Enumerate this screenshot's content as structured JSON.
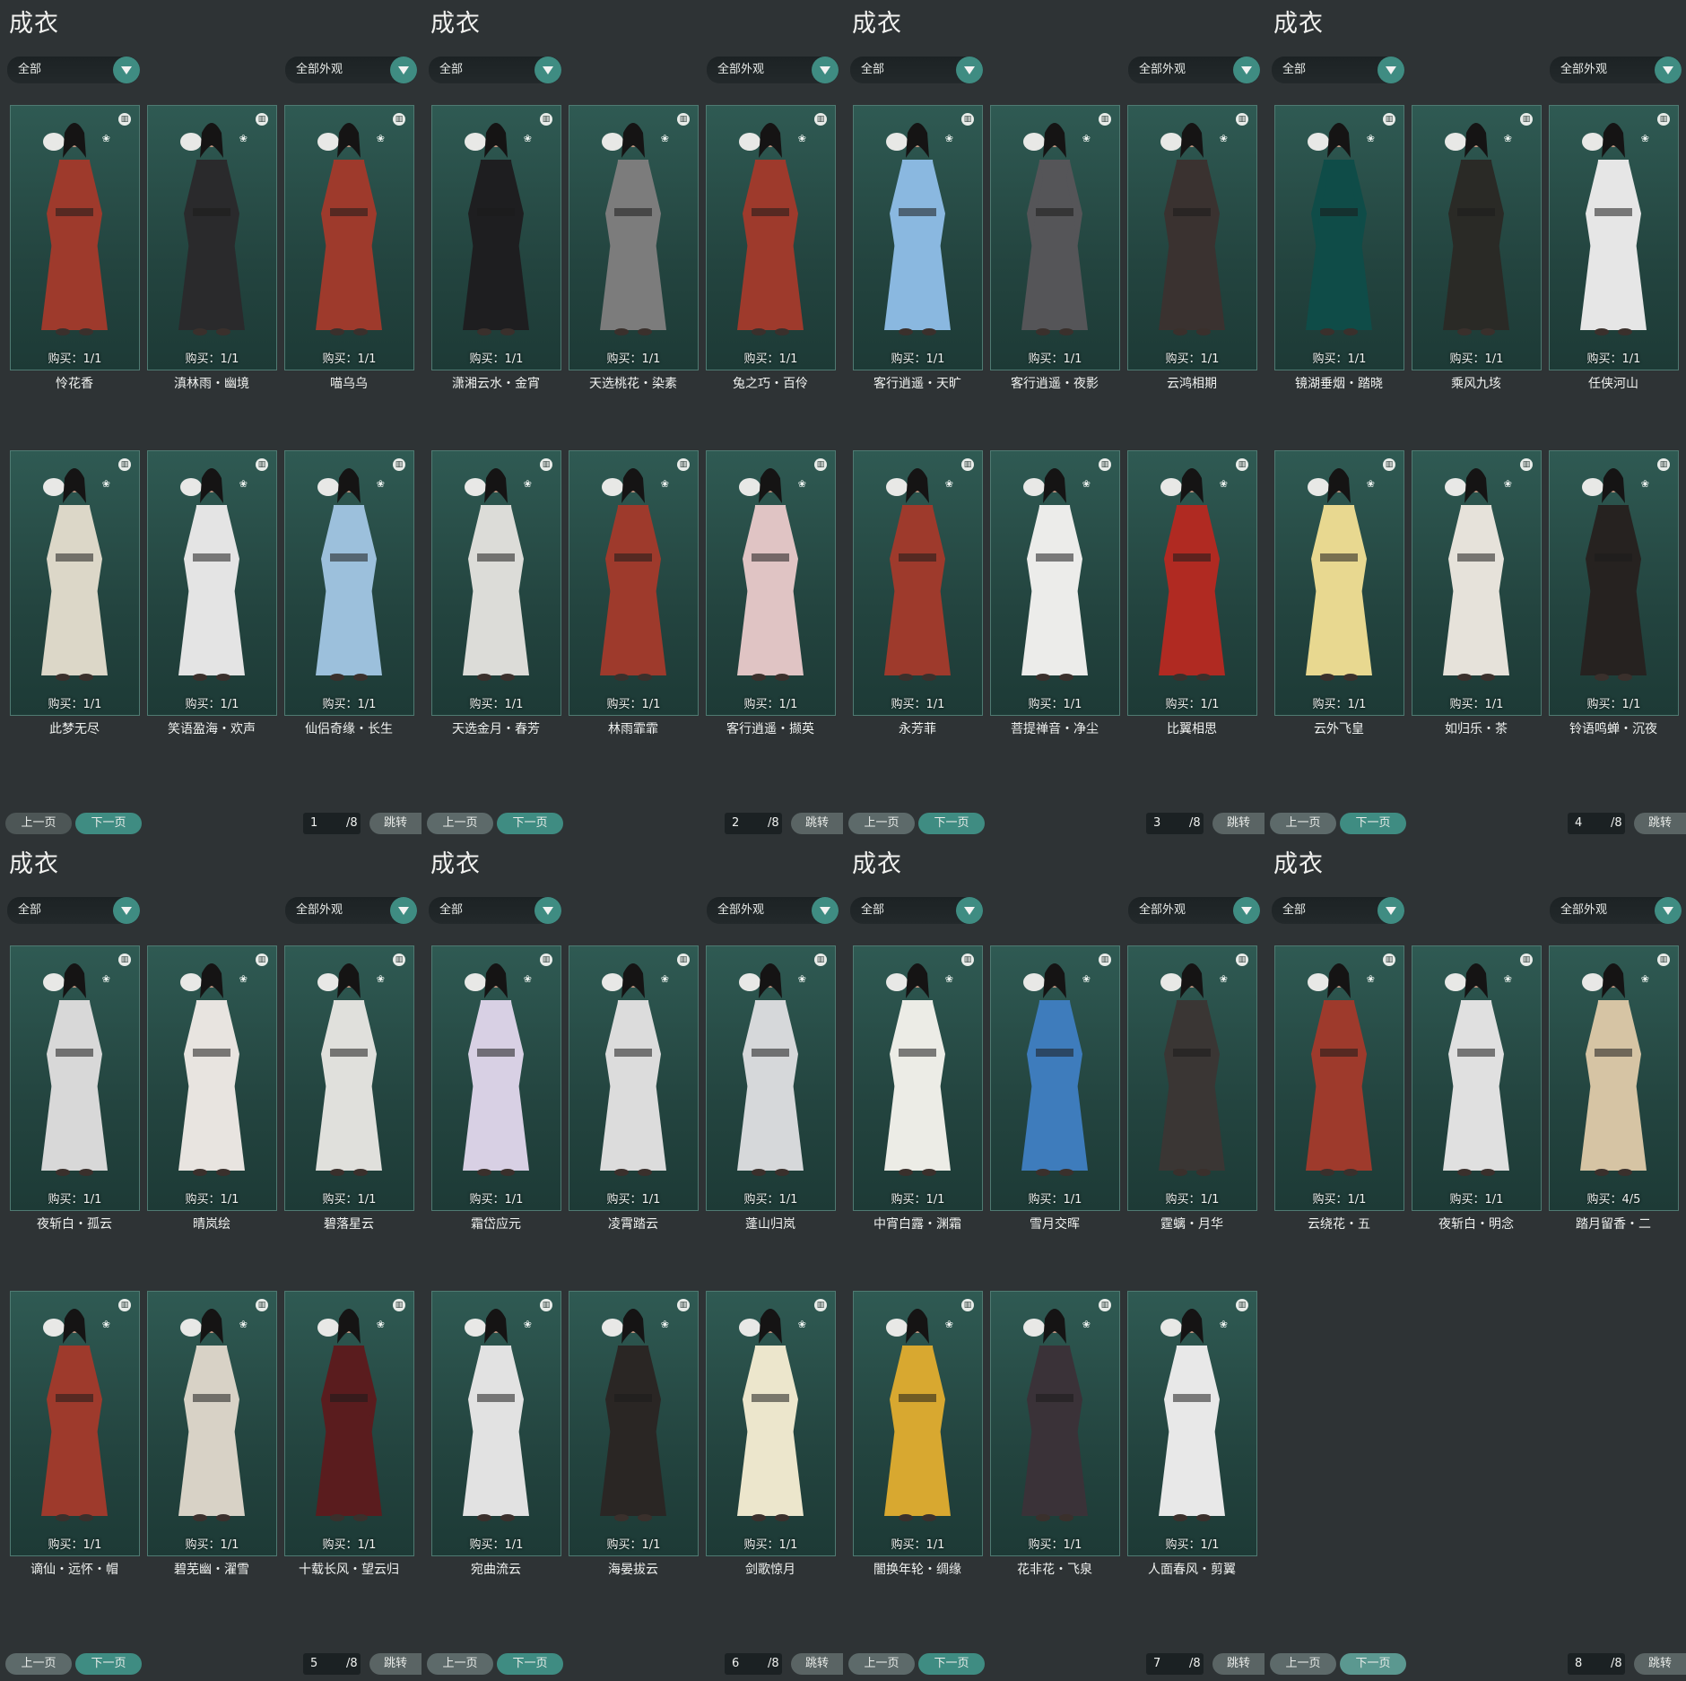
{
  "panels": [
    {
      "title": "成衣",
      "filter_left": "全部",
      "filter_right": "全部外观",
      "prev": "上一页",
      "next": "下一页",
      "page": "1",
      "total": "/8",
      "jump": "跳转",
      "items": [
        {
          "name": "怜花香",
          "buy": "购买：1/1",
          "outfit": "#9e3a2c"
        },
        {
          "name": "滇林雨・幽境",
          "buy": "购买：1/1",
          "outfit": "#2a2a2c"
        },
        {
          "name": "喵乌乌",
          "buy": "购买：1/1",
          "outfit": "#9e3a2c"
        },
        {
          "name": "此梦无尽",
          "buy": "购买：1/1",
          "outfit": "#dcd7c8"
        },
        {
          "name": "笑语盈海・欢声",
          "buy": "购买：1/1",
          "outfit": "#e4e4e4"
        },
        {
          "name": "仙侣奇缘・长生",
          "buy": "购买：1/1",
          "outfit": "#9cc0dc"
        }
      ]
    },
    {
      "title": "成衣",
      "filter_left": "全部",
      "filter_right": "全部外观",
      "prev": "上一页",
      "next": "下一页",
      "page": "2",
      "total": "/8",
      "jump": "跳转",
      "items": [
        {
          "name": "潇湘云水・金宵",
          "buy": "购买：1/1",
          "outfit": "#1e1e20"
        },
        {
          "name": "天选桃花・染素",
          "buy": "购买：1/1",
          "outfit": "#7c7c7c"
        },
        {
          "name": "兔之巧・百伶",
          "buy": "购买：1/1",
          "outfit": "#9e3a2c"
        },
        {
          "name": "天选金月・春芳",
          "buy": "购买：1/1",
          "outfit": "#dcdcd8"
        },
        {
          "name": "林雨霏霏",
          "buy": "购买：1/1",
          "outfit": "#9e3a2c"
        },
        {
          "name": "客行逍遥・撷英",
          "buy": "购买：1/1",
          "outfit": "#e0c4c4"
        }
      ]
    },
    {
      "title": "成衣",
      "filter_left": "全部",
      "filter_right": "全部外观",
      "prev": "上一页",
      "next": "下一页",
      "page": "3",
      "total": "/8",
      "jump": "跳转",
      "items": [
        {
          "name": "客行逍遥・天旷",
          "buy": "购买：1/1",
          "outfit": "#8ab8e0"
        },
        {
          "name": "客行逍遥・夜影",
          "buy": "购买：1/1",
          "outfit": "#555558"
        },
        {
          "name": "云鸿相期",
          "buy": "购买：1/1",
          "outfit": "#3a3230"
        },
        {
          "name": "永芳菲",
          "buy": "购买：1/1",
          "outfit": "#9e3a2c"
        },
        {
          "name": "菩提禅音・净尘",
          "buy": "购买：1/1",
          "outfit": "#ececea"
        },
        {
          "name": "比翼相思",
          "buy": "购买：1/1",
          "outfit": "#b02a22"
        }
      ]
    },
    {
      "title": "成衣",
      "filter_left": "全部",
      "filter_right": "全部外观",
      "prev": "上一页",
      "next": "下一页",
      "page": "4",
      "total": "/8",
      "jump": "跳转",
      "items": [
        {
          "name": "镜湖垂烟・踏晓",
          "buy": "购买：1/1",
          "outfit": "#0f4c48"
        },
        {
          "name": "乘风九垓",
          "buy": "购买：1/1",
          "outfit": "#2a2a26"
        },
        {
          "name": "任侠河山",
          "buy": "购买：1/1",
          "outfit": "#e6e6e6"
        },
        {
          "name": "云外飞皇",
          "buy": "购买：1/1",
          "outfit": "#e8d890"
        },
        {
          "name": "如归乐・茶",
          "buy": "购买：1/1",
          "outfit": "#e6e2da"
        },
        {
          "name": "铃语鸣蝉・沉夜",
          "buy": "购买：1/1",
          "outfit": "#262220"
        }
      ]
    },
    {
      "title": "成衣",
      "filter_left": "全部",
      "filter_right": "全部外观",
      "prev": "上一页",
      "next": "下一页",
      "page": "5",
      "total": "/8",
      "jump": "跳转",
      "items": [
        {
          "name": "夜斩白・孤云",
          "buy": "购买：1/1",
          "outfit": "#d8d8d8"
        },
        {
          "name": "晴岚绘",
          "buy": "购买：1/1",
          "outfit": "#e8e4e0"
        },
        {
          "name": "碧落星云",
          "buy": "购买：1/1",
          "outfit": "#e0e0dc"
        },
        {
          "name": "谪仙・远怀・帽",
          "buy": "购买：1/1",
          "outfit": "#9e3a2c"
        },
        {
          "name": "碧芜幽・濯雪",
          "buy": "购买：1/1",
          "outfit": "#d8d2c6"
        },
        {
          "name": "十载长风・望云归",
          "buy": "购买：1/1",
          "outfit": "#5a1c1e"
        }
      ]
    },
    {
      "title": "成衣",
      "filter_left": "全部",
      "filter_right": "全部外观",
      "prev": "上一页",
      "next": "下一页",
      "page": "6",
      "total": "/8",
      "jump": "跳转",
      "items": [
        {
          "name": "霜岱应元",
          "buy": "购买：1/1",
          "outfit": "#d8d0e4"
        },
        {
          "name": "凌霄踏云",
          "buy": "购买：1/1",
          "outfit": "#dcdcdc"
        },
        {
          "name": "蓬山归岚",
          "buy": "购买：1/1",
          "outfit": "#d6d8da"
        },
        {
          "name": "宛曲流云",
          "buy": "购买：1/1",
          "outfit": "#e2e2e2"
        },
        {
          "name": "海晏拔云",
          "buy": "购买：1/1",
          "outfit": "#2a2624"
        },
        {
          "name": "剑歌惊月",
          "buy": "购买：1/1",
          "outfit": "#ece6cc"
        }
      ]
    },
    {
      "title": "成衣",
      "filter_left": "全部",
      "filter_right": "全部外观",
      "prev": "上一页",
      "next": "下一页",
      "page": "7",
      "total": "/8",
      "jump": "跳转",
      "items": [
        {
          "name": "中宵白露・渊霜",
          "buy": "购买：1/1",
          "outfit": "#ecece6"
        },
        {
          "name": "雪月交晖",
          "buy": "购买：1/1",
          "outfit": "#3e7cbc"
        },
        {
          "name": "霆螭・月华",
          "buy": "购买：1/1",
          "outfit": "#3a3634"
        },
        {
          "name": "闇换年轮・绸缘",
          "buy": "购买：1/1",
          "outfit": "#d8a830"
        },
        {
          "name": "花非花・飞泉",
          "buy": "购买：1/1",
          "outfit": "#3a3238"
        },
        {
          "name": "人面春风・剪翼",
          "buy": "购买：1/1",
          "outfit": "#e8e8e8"
        }
      ]
    },
    {
      "title": "成衣",
      "filter_left": "全部",
      "filter_right": "全部外观",
      "prev": "上一页",
      "next": "下一页",
      "page": "8",
      "total": "/8",
      "jump": "跳转",
      "items": [
        {
          "name": "云绕花・五",
          "buy": "购买：1/1",
          "outfit": "#9e3a2c"
        },
        {
          "name": "夜斩白・明念",
          "buy": "购买：1/1",
          "outfit": "#e0e0e0"
        },
        {
          "name": "踏月留香・二",
          "buy": "购买：4/5",
          "outfit": "#d6c4a4"
        }
      ]
    }
  ],
  "icons": {
    "trash": "trash-icon",
    "butterfly": "butterfly-icon",
    "dropdown": "chevron-down-icon"
  }
}
